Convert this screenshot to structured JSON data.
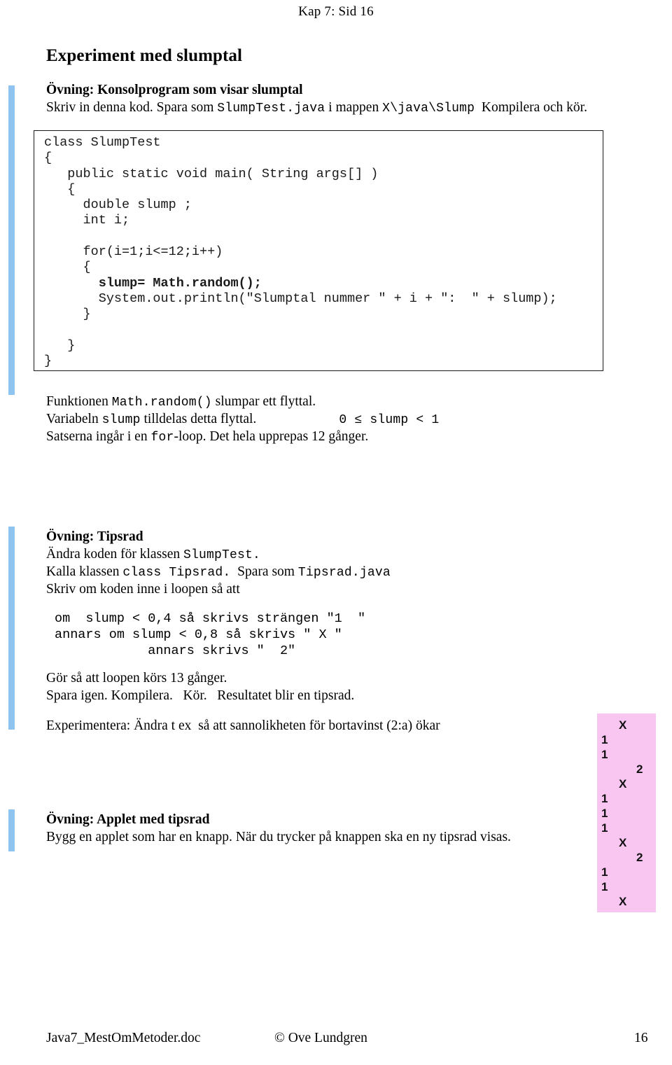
{
  "header": {
    "running_head": "Kap 7:  Sid  16"
  },
  "title": "Experiment med slumptal",
  "exercise1": {
    "heading": "Övning:  Konsolprogram som visar slumptal",
    "instruction_prefix": "Skriv in denna kod. Spara som ",
    "instruction_file": "SlumpTest.java",
    "instruction_mid": " i mappen ",
    "instruction_path": "X\\java\\Slump",
    "instruction_suffix": "  Kompilera och kör."
  },
  "code_block": {
    "line1": "class SlumpTest",
    "line2": "{",
    "line3": "   public static void main( String args[] )",
    "line4": "   {",
    "line5": "     double slump ;",
    "line6": "     int i;",
    "line7": "",
    "line8": "     for(i=1;i<=12;i++)",
    "line9": "     {",
    "line10_bold": "       slump= Math.random();",
    "line11": "       System.out.println(\"Slumptal nummer \" + i + \":  \" + slump);",
    "line12": "     }",
    "line13": "",
    "line14": "   }",
    "line15": "}"
  },
  "explanation": {
    "l1_a": "Funktionen ",
    "l1_code": "Math.random()",
    "l1_b": " slumpar ett flyttal.",
    "l2_a": "Variabeln ",
    "l2_code": "slump",
    "l2_b": " tilldelas detta flyttal.",
    "l2_ineq": "0 ≤ slump < 1",
    "l3_a": "Satserna ingår i en ",
    "l3_code": "for",
    "l3_b": "-loop. Det hela upprepas 12 gånger."
  },
  "exercise2": {
    "heading": "Övning: Tipsrad",
    "l1_a": "Ändra koden för klassen ",
    "l1_code": "SlumpTest.",
    "l2_a": "Kalla klassen ",
    "l2_code": "class Tipsrad.",
    "l2_b": "  Spara som ",
    "l2_code2": "Tipsrad.java",
    "l3": "Skriv om koden inne i loopen så att",
    "pseudo1": "om  slump < 0,4 så skrivs strängen \"1  \"",
    "pseudo2": "annars om slump < 0,8 så skrivs \" X \"",
    "pseudo3": "            annars skrivs \"  2\"",
    "l4": "Gör så att loopen körs 13 gånger.",
    "l5": "Spara igen. Kompilera.   Kör.   Resultatet blir en tipsrad.",
    "l6": "Experimentera: Ändra t ex  så att sannolikheten för bortavinst (2:a) ökar"
  },
  "tipsrad_result": {
    "rows": [
      {
        "col": "X"
      },
      {
        "col": "1"
      },
      {
        "col": "1"
      },
      {
        "col": "2"
      },
      {
        "col": "X"
      },
      {
        "col": "1"
      },
      {
        "col": "1"
      },
      {
        "col": "1"
      },
      {
        "col": "X"
      },
      {
        "col": "2"
      },
      {
        "col": "1"
      },
      {
        "col": "1"
      },
      {
        "col": "X"
      }
    ],
    "values": [
      "X",
      "1",
      "1",
      "2",
      "X",
      "1",
      "1",
      "1",
      "X",
      "2",
      "1",
      "1",
      "X"
    ],
    "background_color": "#f9c6f2"
  },
  "exercise3": {
    "heading": "Övning: Applet med tipsrad",
    "body": "Bygg en applet som har en knapp. När du trycker på knappen ska en ny tipsrad visas."
  },
  "footer": {
    "left": "Java7_MestOmMetoder.doc",
    "center": "© Ove Lundgren",
    "right": "16"
  },
  "accent": {
    "change_bar_color": "#8fc4f0"
  }
}
